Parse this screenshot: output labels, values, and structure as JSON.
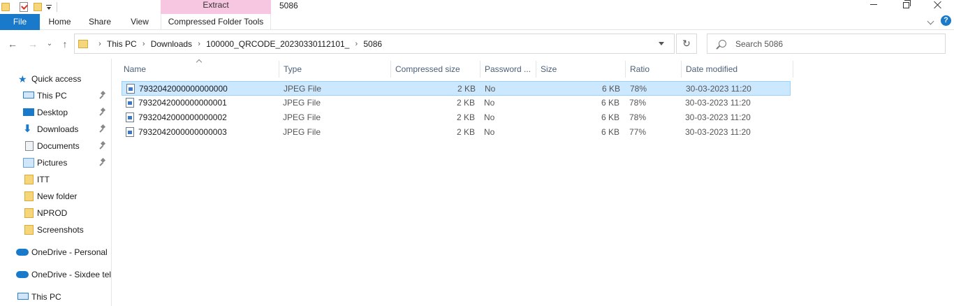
{
  "window": {
    "title": "5086",
    "context_tab_group": "Extract"
  },
  "ribbon": {
    "tabs": [
      "File",
      "Home",
      "Share",
      "View",
      "Compressed Folder Tools"
    ],
    "help": "?"
  },
  "address": {
    "crumbs": [
      "This PC",
      "Downloads",
      "100000_QRCODE_20230330112101_",
      "5086"
    ],
    "search_placeholder": "Search 5086"
  },
  "nav": {
    "items": [
      {
        "label": "Quick access",
        "icon": "star-icon",
        "pinned": false
      },
      {
        "label": "This PC",
        "icon": "computer-icon",
        "pinned": true
      },
      {
        "label": "Desktop",
        "icon": "desktop-icon",
        "pinned": true
      },
      {
        "label": "Downloads",
        "icon": "download-icon",
        "pinned": true
      },
      {
        "label": "Documents",
        "icon": "document-icon",
        "pinned": true
      },
      {
        "label": "Pictures",
        "icon": "pictures-icon",
        "pinned": true
      },
      {
        "label": "ITT",
        "icon": "folder-icon",
        "pinned": false
      },
      {
        "label": "New folder",
        "icon": "folder-icon",
        "pinned": false
      },
      {
        "label": "NPROD",
        "icon": "folder-icon",
        "pinned": false
      },
      {
        "label": "Screenshots",
        "icon": "folder-icon",
        "pinned": false
      },
      {
        "label": "OneDrive - Personal",
        "icon": "onedrive-icon",
        "pinned": false
      },
      {
        "label": "OneDrive - Sixdee tel",
        "icon": "onedrive-icon",
        "pinned": false
      },
      {
        "label": "This PC",
        "icon": "computer-icon",
        "pinned": false
      }
    ]
  },
  "columns": [
    "Name",
    "Type",
    "Compressed size",
    "Password ...",
    "Size",
    "Ratio",
    "Date modified"
  ],
  "files": [
    {
      "name": "7932042000000000000",
      "type": "JPEG File",
      "compressed": "2 KB",
      "password": "No",
      "size": "6 KB",
      "ratio": "78%",
      "date": "30-03-2023 11:20",
      "selected": true
    },
    {
      "name": "7932042000000000001",
      "type": "JPEG File",
      "compressed": "2 KB",
      "password": "No",
      "size": "6 KB",
      "ratio": "78%",
      "date": "30-03-2023 11:20",
      "selected": false
    },
    {
      "name": "7932042000000000002",
      "type": "JPEG File",
      "compressed": "2 KB",
      "password": "No",
      "size": "6 KB",
      "ratio": "78%",
      "date": "30-03-2023 11:20",
      "selected": false
    },
    {
      "name": "7932042000000000003",
      "type": "JPEG File",
      "compressed": "2 KB",
      "password": "No",
      "size": "6 KB",
      "ratio": "77%",
      "date": "30-03-2023 11:20",
      "selected": false
    }
  ],
  "colors": {
    "accent": "#1979ca",
    "context_tab": "#f7c6e0",
    "selection": "#cce8ff"
  }
}
